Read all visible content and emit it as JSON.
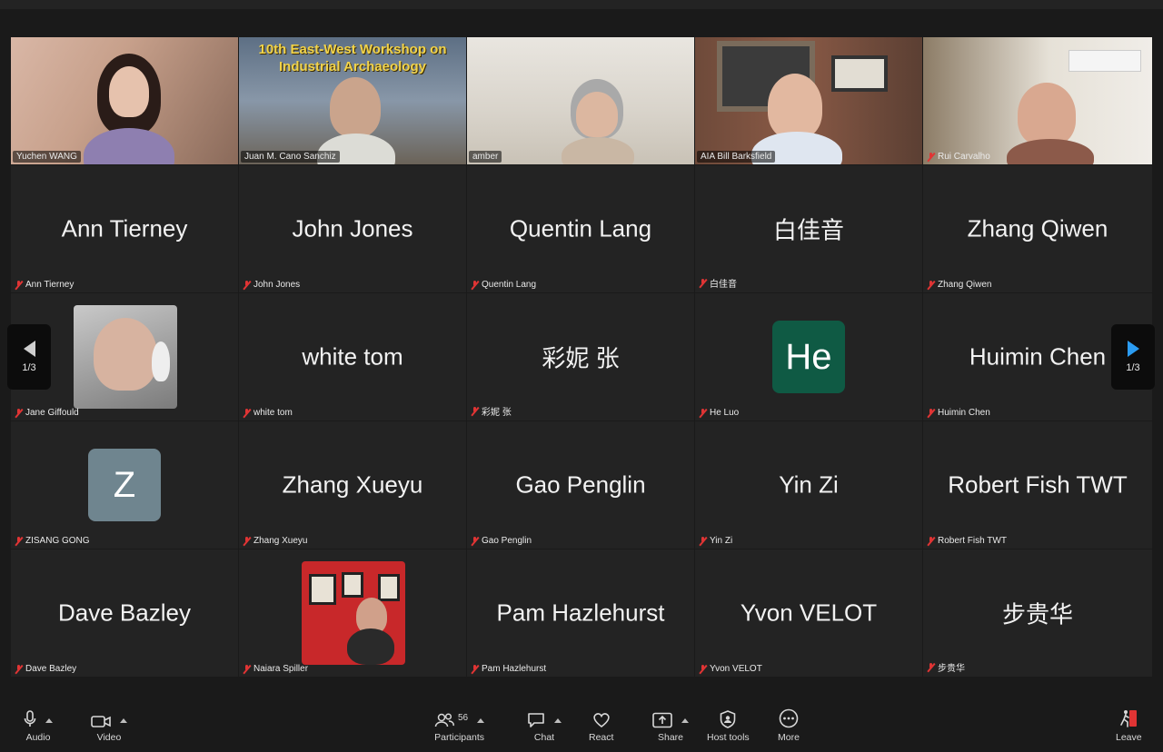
{
  "meeting": {
    "banner_line1": "10th East-West Workshop on",
    "banner_line2": "Industrial Archaeology",
    "banner_sup": "th"
  },
  "video_tiles": [
    {
      "name": "Yuchen WANG"
    },
    {
      "name": "Juan M. Cano Sanchiz"
    },
    {
      "name": "amber"
    },
    {
      "name": "AIA Bill Barksfield"
    },
    {
      "name": "Rui Carvalho"
    }
  ],
  "grid_rows": [
    [
      {
        "display": "Ann Tierney",
        "label": "Ann Tierney"
      },
      {
        "display": "John Jones",
        "label": "John Jones"
      },
      {
        "display": "Quentin Lang",
        "label": "Quentin Lang"
      },
      {
        "display": "白佳音",
        "label": "白佳音"
      },
      {
        "display": "Zhang Qiwen",
        "label": "Zhang Qiwen"
      }
    ],
    [
      {
        "display": "",
        "label": "Jane Giffould"
      },
      {
        "display": "white tom",
        "label": "white tom"
      },
      {
        "display": "彩妮 张",
        "label": "彩妮 张"
      },
      {
        "display": "He",
        "label": "He Luo"
      },
      {
        "display": "Huimin Chen",
        "label": "Huimin Chen"
      }
    ],
    [
      {
        "display": "Z",
        "label": "ZISANG GONG"
      },
      {
        "display": "Zhang Xueyu",
        "label": "Zhang Xueyu"
      },
      {
        "display": "Gao Penglin",
        "label": "Gao Penglin"
      },
      {
        "display": "Yin Zi",
        "label": "Yin Zi"
      },
      {
        "display": "Robert Fish TWT",
        "label": "Robert Fish TWT"
      }
    ],
    [
      {
        "display": "Dave Bazley",
        "label": "Dave Bazley"
      },
      {
        "display": "",
        "label": "Naiara Spiller"
      },
      {
        "display": "Pam Hazlehurst",
        "label": "Pam Hazlehurst"
      },
      {
        "display": "Yvon VELOT",
        "label": "Yvon VELOT"
      },
      {
        "display": "步贵华",
        "label": "步贵华"
      }
    ]
  ],
  "pagination": {
    "left": "1/3",
    "right": "1/3"
  },
  "toolbar": {
    "audio": "Audio",
    "video": "Video",
    "participants": "Participants",
    "participants_count": "56",
    "chat": "Chat",
    "react": "React",
    "share": "Share",
    "host_tools": "Host tools",
    "more": "More",
    "leave": "Leave"
  },
  "colors": {
    "background": "#1a1a1a",
    "tile": "#232323",
    "active_speaker": "#2ecc40",
    "avatar_he": "#0f5a44",
    "avatar_z": "#6f858f",
    "muted": "#e03434",
    "nav_arrow": "#2b9cf2",
    "leave": "#e03434"
  }
}
